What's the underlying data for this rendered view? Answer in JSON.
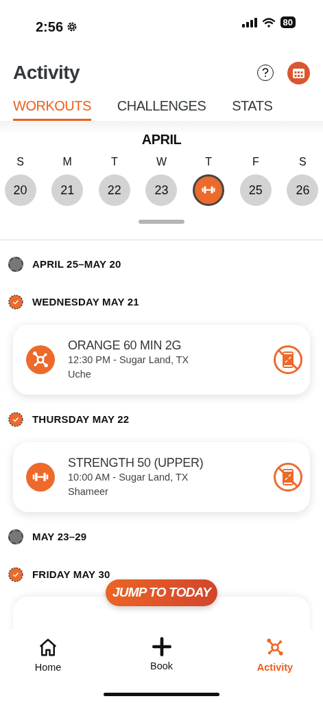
{
  "status_bar": {
    "time": "2:56",
    "battery": "80"
  },
  "header": {
    "title": "Activity"
  },
  "tabs": [
    {
      "label": "WORKOUTS",
      "selected": true
    },
    {
      "label": "CHALLENGES",
      "selected": false
    },
    {
      "label": "STATS",
      "selected": false
    }
  ],
  "calendar": {
    "month": "APRIL",
    "days": [
      {
        "weekday": "S",
        "date": "20",
        "kind": "date",
        "selected": false
      },
      {
        "weekday": "M",
        "date": "21",
        "kind": "date",
        "selected": false
      },
      {
        "weekday": "T",
        "date": "22",
        "kind": "date",
        "selected": false
      },
      {
        "weekday": "W",
        "date": "23",
        "kind": "date",
        "selected": false
      },
      {
        "weekday": "T",
        "kind": "workout",
        "selected": true
      },
      {
        "weekday": "F",
        "date": "25",
        "kind": "date",
        "selected": false
      },
      {
        "weekday": "S",
        "date": "26",
        "kind": "date",
        "selected": false
      }
    ]
  },
  "timeline": [
    {
      "kind": "range",
      "label": "APRIL 25–MAY 20"
    },
    {
      "kind": "day",
      "label": "WEDNESDAY MAY 21",
      "workouts": [
        {
          "kind": "orange",
          "title": "ORANGE 60 MIN 2G",
          "detail": "12:30 PM - Sugar Land, TX",
          "coach": "Uche"
        }
      ]
    },
    {
      "kind": "day",
      "label": "THURSDAY MAY 22",
      "workouts": [
        {
          "kind": "strength",
          "title": "STRENGTH 50 (UPPER)",
          "detail": "10:00 AM - Sugar Land, TX",
          "coach": "Shameer"
        }
      ]
    },
    {
      "kind": "range",
      "label": "MAY 23–29"
    },
    {
      "kind": "day",
      "label": "FRIDAY MAY 30",
      "partial_card": true
    }
  ],
  "jump_button": "JUMP TO TODAY",
  "nav": [
    {
      "label": "Home",
      "kind": "home",
      "selected": false
    },
    {
      "label": "Book",
      "kind": "book",
      "selected": false
    },
    {
      "label": "Activity",
      "kind": "activity",
      "selected": true
    }
  ]
}
